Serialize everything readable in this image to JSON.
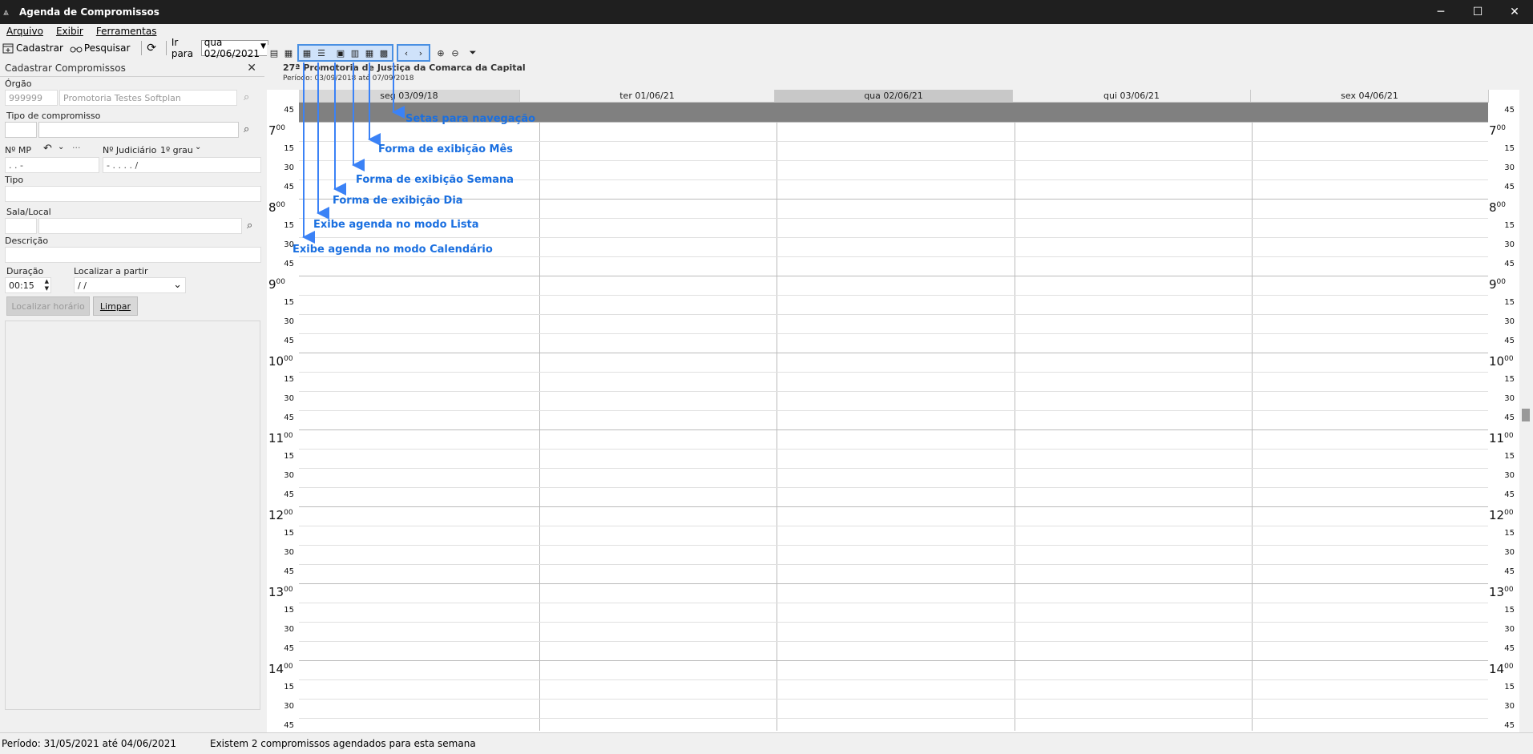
{
  "window": {
    "title": "Agenda de Compromissos",
    "min": "─",
    "max": "☐",
    "close": "✕"
  },
  "menu": [
    "Arquivo",
    "Exibir",
    "Ferramentas"
  ],
  "toolbar": {
    "cadastrar": "Cadastrar",
    "pesquisar": "Pesquisar",
    "ir_para_label": "Ir para",
    "ir_para_value": "qua 02/06/2021"
  },
  "left_panel": {
    "header": "Cadastrar Compromissos",
    "orgao_label": "Órgão",
    "orgao_code": "999999",
    "orgao_name": "Promotoria Testes Softplan",
    "tipo_compromisso_label": "Tipo de compromisso",
    "nmp_label": "Nº MP",
    "nmp_value": ".   .     -",
    "njudiciario_label": "Nº Judiciário",
    "grau": "1º grau",
    "njud_value": "-  .  .  .  .   /",
    "tipo_label": "Tipo",
    "sala_label": "Sala/Local",
    "descricao_label": "Descrição",
    "duracao_label": "Duração",
    "duracao_value": "00:15",
    "localizar_partir_label": "Localizar a partir",
    "localizar_partir_value": " /  /",
    "localizar_horario_btn": "Localizar horário",
    "limpar_btn": "Limpar"
  },
  "calendar": {
    "title": "27ª Promotoria de Justiça da Comarca da Capital",
    "period_small": "Período: 03/09/2018 até 07/09/2018",
    "days": [
      "seg 03/09/18",
      "ter 01/06/21",
      "qua 02/06/21",
      "qui 03/06/21",
      "sex 04/06/21"
    ],
    "hours": [
      "7",
      "8",
      "9",
      "10",
      "11",
      "12",
      "13",
      "14"
    ],
    "quarters": [
      "15",
      "30",
      "45"
    ],
    "first_label": "45",
    "sup": "00"
  },
  "annotations": {
    "setas": "Setas para navegação",
    "mes": "Forma de exibição Mês",
    "semana": "Forma de exibição Semana",
    "dia": "Forma de exibição Dia",
    "lista": "Exibe agenda no modo Lista",
    "calendario": "Exibe agenda no modo Calendário"
  },
  "status": {
    "periodo": "Período: 31/05/2021 até 04/06/2021",
    "info": "Existem 2 compromissos agendados para esta semana"
  }
}
